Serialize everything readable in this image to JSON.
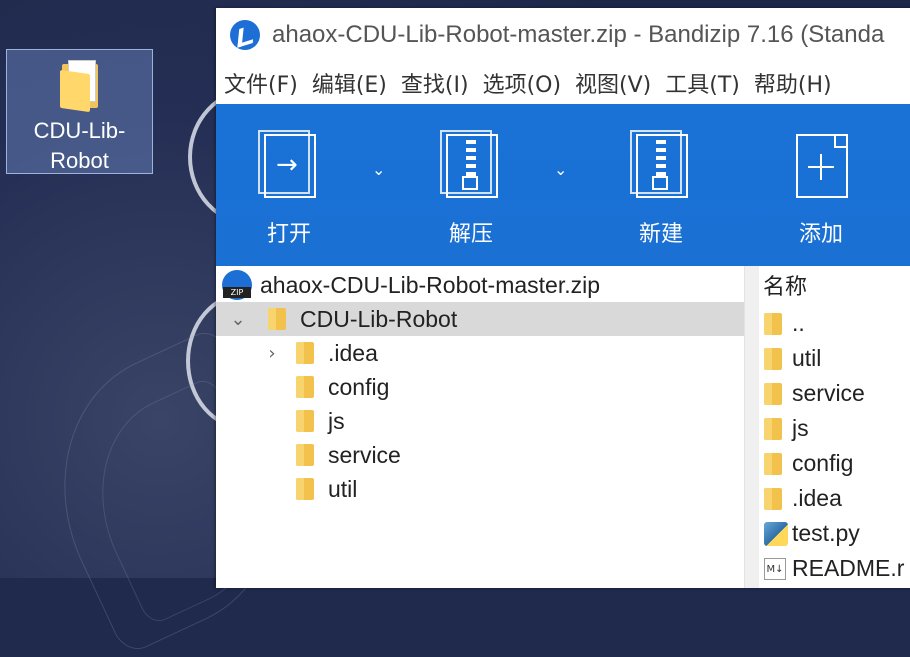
{
  "desktop": {
    "icon_label": "CDU-Lib-Robot"
  },
  "window": {
    "title": "ahaox-CDU-Lib-Robot-master.zip - Bandizip 7.16 (Standa"
  },
  "menu": {
    "items": [
      "文件(F)",
      "编辑(E)",
      "查找(I)",
      "选项(O)",
      "视图(V)",
      "工具(T)",
      "帮助(H)"
    ]
  },
  "toolbar": {
    "open_label": "打开",
    "extract_label": "解压",
    "new_label": "新建",
    "add_label": "添加",
    "dropdown_glyph": "⌄",
    "arrow_glyph": "→"
  },
  "tree": {
    "archive": "ahaox-CDU-Lib-Robot-master.zip",
    "root_folder": "CDU-Lib-Robot",
    "root_chevron": "⌄",
    "expand_chevron": "›",
    "children": [
      ".idea",
      "config",
      "js",
      "service",
      "util"
    ]
  },
  "list": {
    "header": "名称",
    "items": [
      "..",
      "util",
      "service",
      "js",
      "config",
      ".idea",
      "test.py",
      "README.r"
    ],
    "md_glyph": "M↓"
  },
  "colors": {
    "accent": "#1b70d4",
    "folder": "#f2c24d",
    "selection": "#d9d9d9"
  }
}
